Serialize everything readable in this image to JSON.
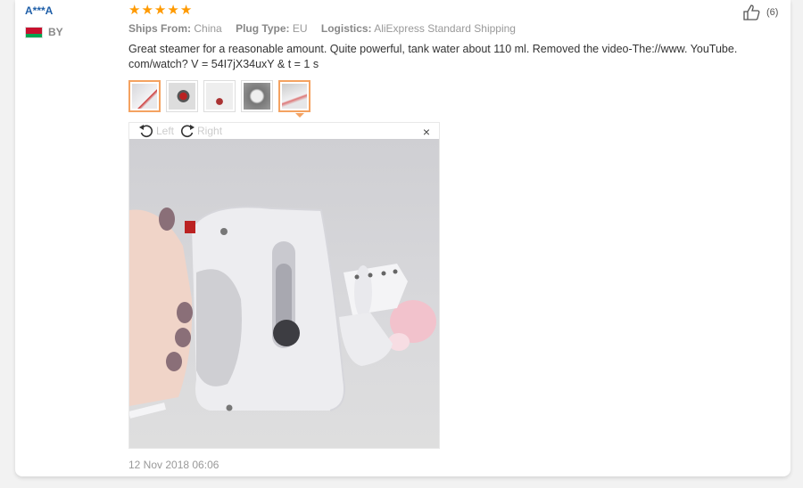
{
  "review": {
    "username": "A***A",
    "country": "BY",
    "rating": 5,
    "stars": [
      "★",
      "★",
      "★",
      "★",
      "★"
    ],
    "meta": {
      "ships_from_label": "Ships From:",
      "ships_from_value": "China",
      "plug_type_label": "Plug Type:",
      "plug_type_value": "EU",
      "logistics_label": "Logistics:",
      "logistics_value": "AliExpress Standard Shipping"
    },
    "text": "Great steamer for a reasonable amount. Quite powerful, tank water about 110 ml. Removed the video-The://www. YouTube. com/watch? V = 54I7jX34uxY & t = 1 s",
    "helpful_count": "(6)",
    "date": "12 Nov 2018 06:06"
  },
  "viewer": {
    "left_label": "Left",
    "right_label": "Right",
    "close_symbol": "×",
    "thumbnail_count": 5,
    "selected_thumbnail": 5
  },
  "colors": {
    "accent": "#ff9a00",
    "username": "#1f5fa8",
    "thumb_selected": "#f4a261"
  }
}
